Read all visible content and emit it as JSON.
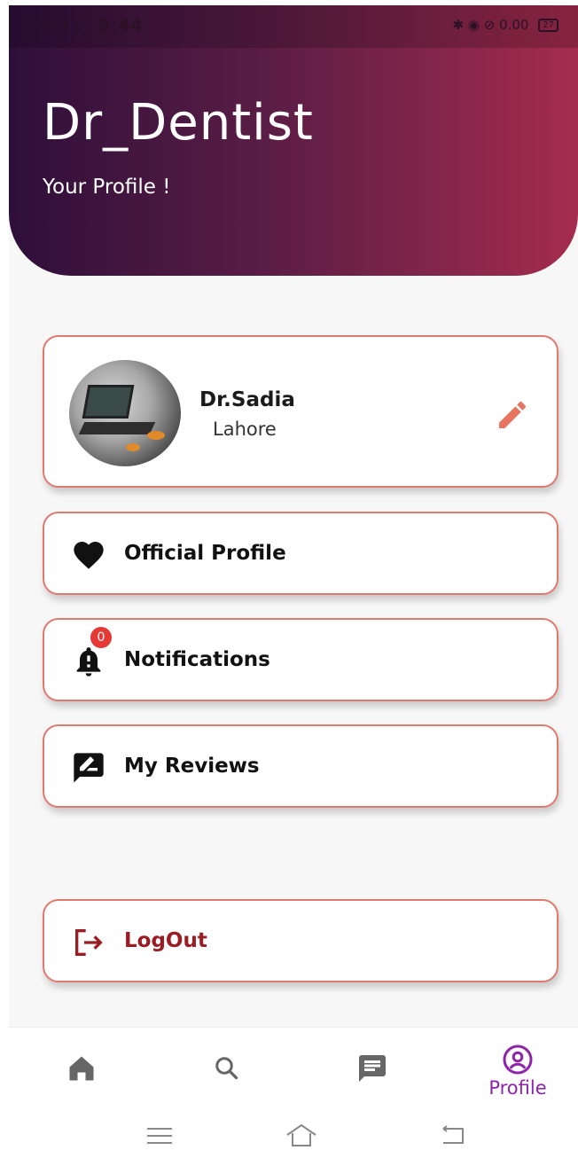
{
  "status_bar": {
    "left_icons": "⇅ ↑↓",
    "time": "9:44",
    "right_text": "✱ ◉ ⊘ 0.00",
    "battery": "27"
  },
  "header": {
    "title": "Dr_Dentist",
    "subtitle": "Your Profile !"
  },
  "profile_card": {
    "name": "Dr.Sadia",
    "city": "Lahore"
  },
  "menu": {
    "official_profile": "Official Profile",
    "notifications": "Notifications",
    "notifications_count": "0",
    "my_reviews": "My Reviews",
    "logout": "LogOut"
  },
  "bottom_nav": {
    "profile_label": "Profile",
    "active": "profile"
  },
  "colors": {
    "header_start": "#2e0f3a",
    "header_end": "#a52c4e",
    "card_border": "#e07a6f",
    "edit_icon": "#e8735f",
    "logout": "#9b1c22",
    "active_nav": "#8e24aa",
    "badge": "#e53935"
  },
  "icons": {
    "edit": "pencil-icon",
    "official_profile": "heart-icon",
    "notifications": "bell-icon",
    "reviews": "review-icon",
    "logout": "logout-icon",
    "nav_home": "home-icon",
    "nav_search": "search-icon",
    "nav_chat": "chat-icon",
    "nav_profile": "account-circle-icon"
  }
}
